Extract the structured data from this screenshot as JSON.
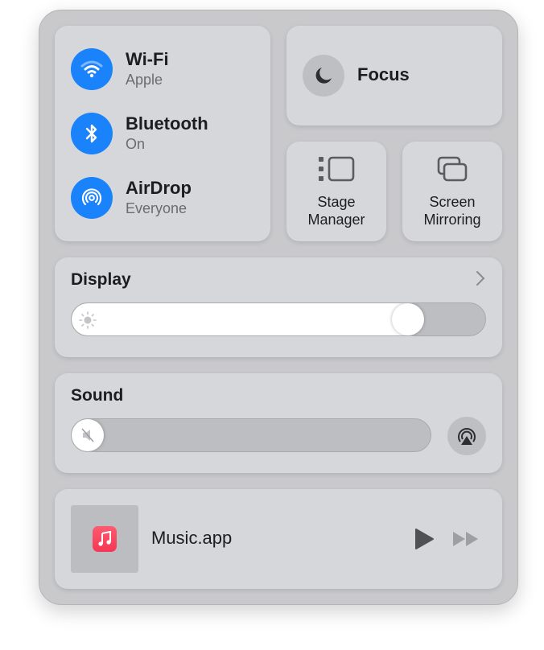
{
  "connectivity": [
    {
      "title": "Wi-Fi",
      "subtitle": "Apple",
      "icon": "wifi-icon"
    },
    {
      "title": "Bluetooth",
      "subtitle": "On",
      "icon": "bluetooth-icon"
    },
    {
      "title": "AirDrop",
      "subtitle": "Everyone",
      "icon": "airdrop-icon"
    }
  ],
  "focus": {
    "label": "Focus",
    "icon": "moon-icon"
  },
  "stage_manager": {
    "label_line1": "Stage",
    "label_line2": "Manager",
    "icon": "stage-manager-icon"
  },
  "screen_mirroring": {
    "label_line1": "Screen",
    "label_line2": "Mirroring",
    "icon": "screen-mirroring-icon"
  },
  "display": {
    "title": "Display",
    "brightness_percent": 84,
    "icon": "sun-icon"
  },
  "sound": {
    "title": "Sound",
    "volume_percent": 0,
    "icon": "speaker-muted-icon"
  },
  "now_playing": {
    "title": "Music.app",
    "app_icon": "music-note-icon"
  },
  "colors": {
    "accent": "#1a82fb",
    "tile": "#d6d7db",
    "panel": "#c9c9cc"
  }
}
